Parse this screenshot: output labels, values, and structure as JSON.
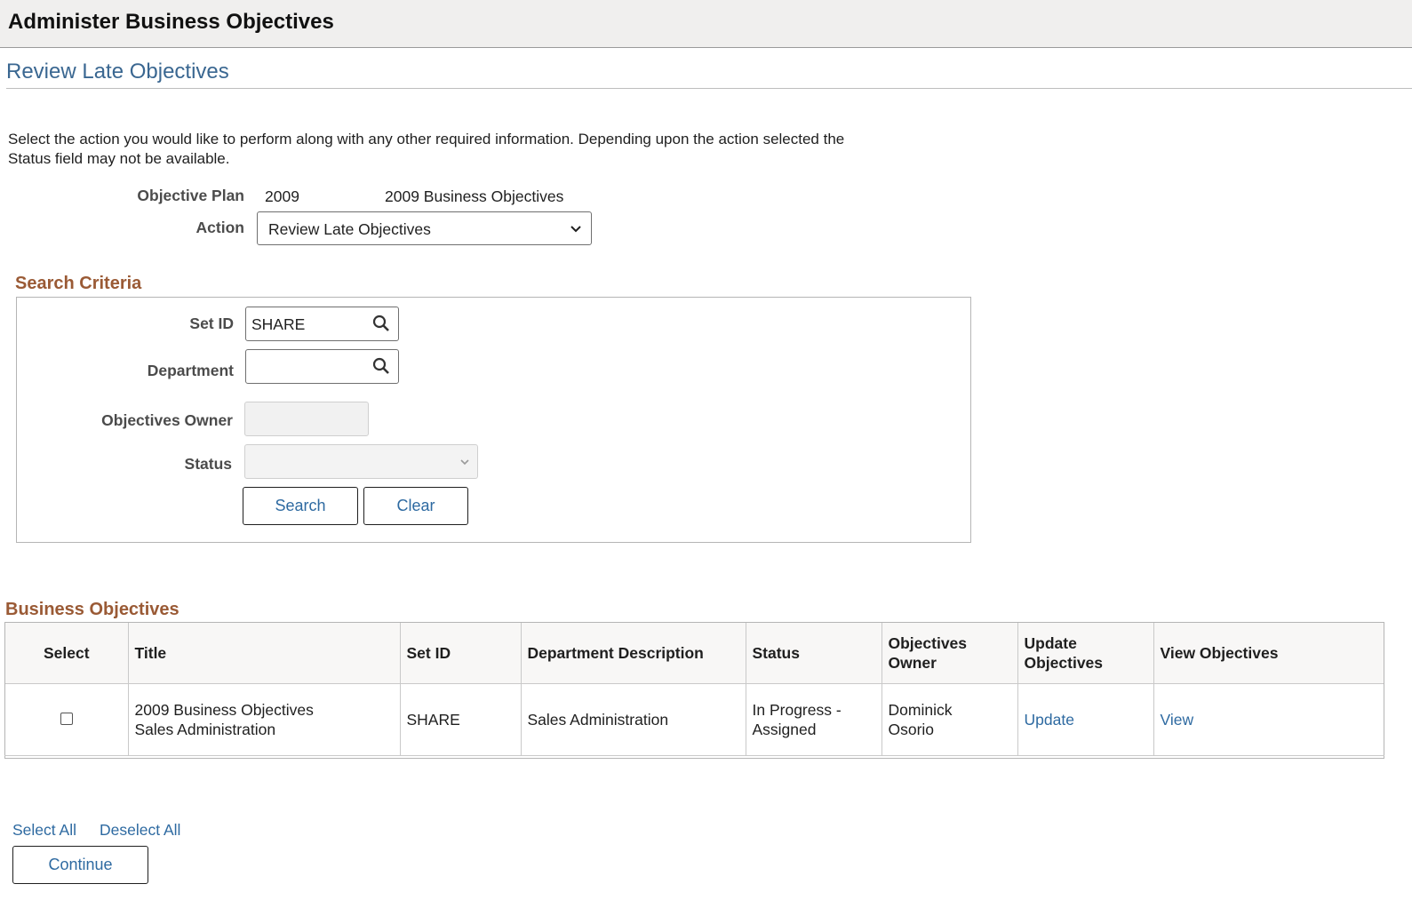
{
  "page": {
    "title": "Administer Business Objectives",
    "subtitle": "Review Late Objectives",
    "instructions": "Select the action you would like to perform along with any other required information. Depending upon the action selected the Status field may not be available."
  },
  "plan": {
    "objective_plan_label": "Objective Plan",
    "objective_plan_code": "2009",
    "objective_plan_name": "2009 Business Objectives",
    "action_label": "Action",
    "action_value": "Review Late Objectives"
  },
  "search": {
    "section_title": "Search Criteria",
    "setid_label": "Set ID",
    "setid_value": "SHARE",
    "department_label": "Department",
    "department_value": "",
    "owner_label": "Objectives Owner",
    "status_label": "Status",
    "search_button": "Search",
    "clear_button": "Clear"
  },
  "objectives": {
    "section_title": "Business Objectives",
    "columns": [
      "Select",
      "Title",
      "Set ID",
      "Department Description",
      "Status",
      "Objectives Owner",
      "Update Objectives",
      "View Objectives"
    ],
    "rows": [
      {
        "title_line1": "2009 Business Objectives",
        "title_line2": "Sales Administration",
        "setid": "SHARE",
        "dept_desc": "Sales Administration",
        "status_line1": "In Progress -",
        "status_line2": "Assigned",
        "owner_line1": "Dominick",
        "owner_line2": "Osorio",
        "update_link": "Update",
        "view_link": "View"
      }
    ]
  },
  "footer": {
    "select_all": "Select All",
    "deselect_all": "Deselect All",
    "continue_button": "Continue"
  },
  "colors": {
    "link": "#2e6aa1",
    "section_title": "#9a5a35",
    "subtitle": "#3a6791"
  }
}
